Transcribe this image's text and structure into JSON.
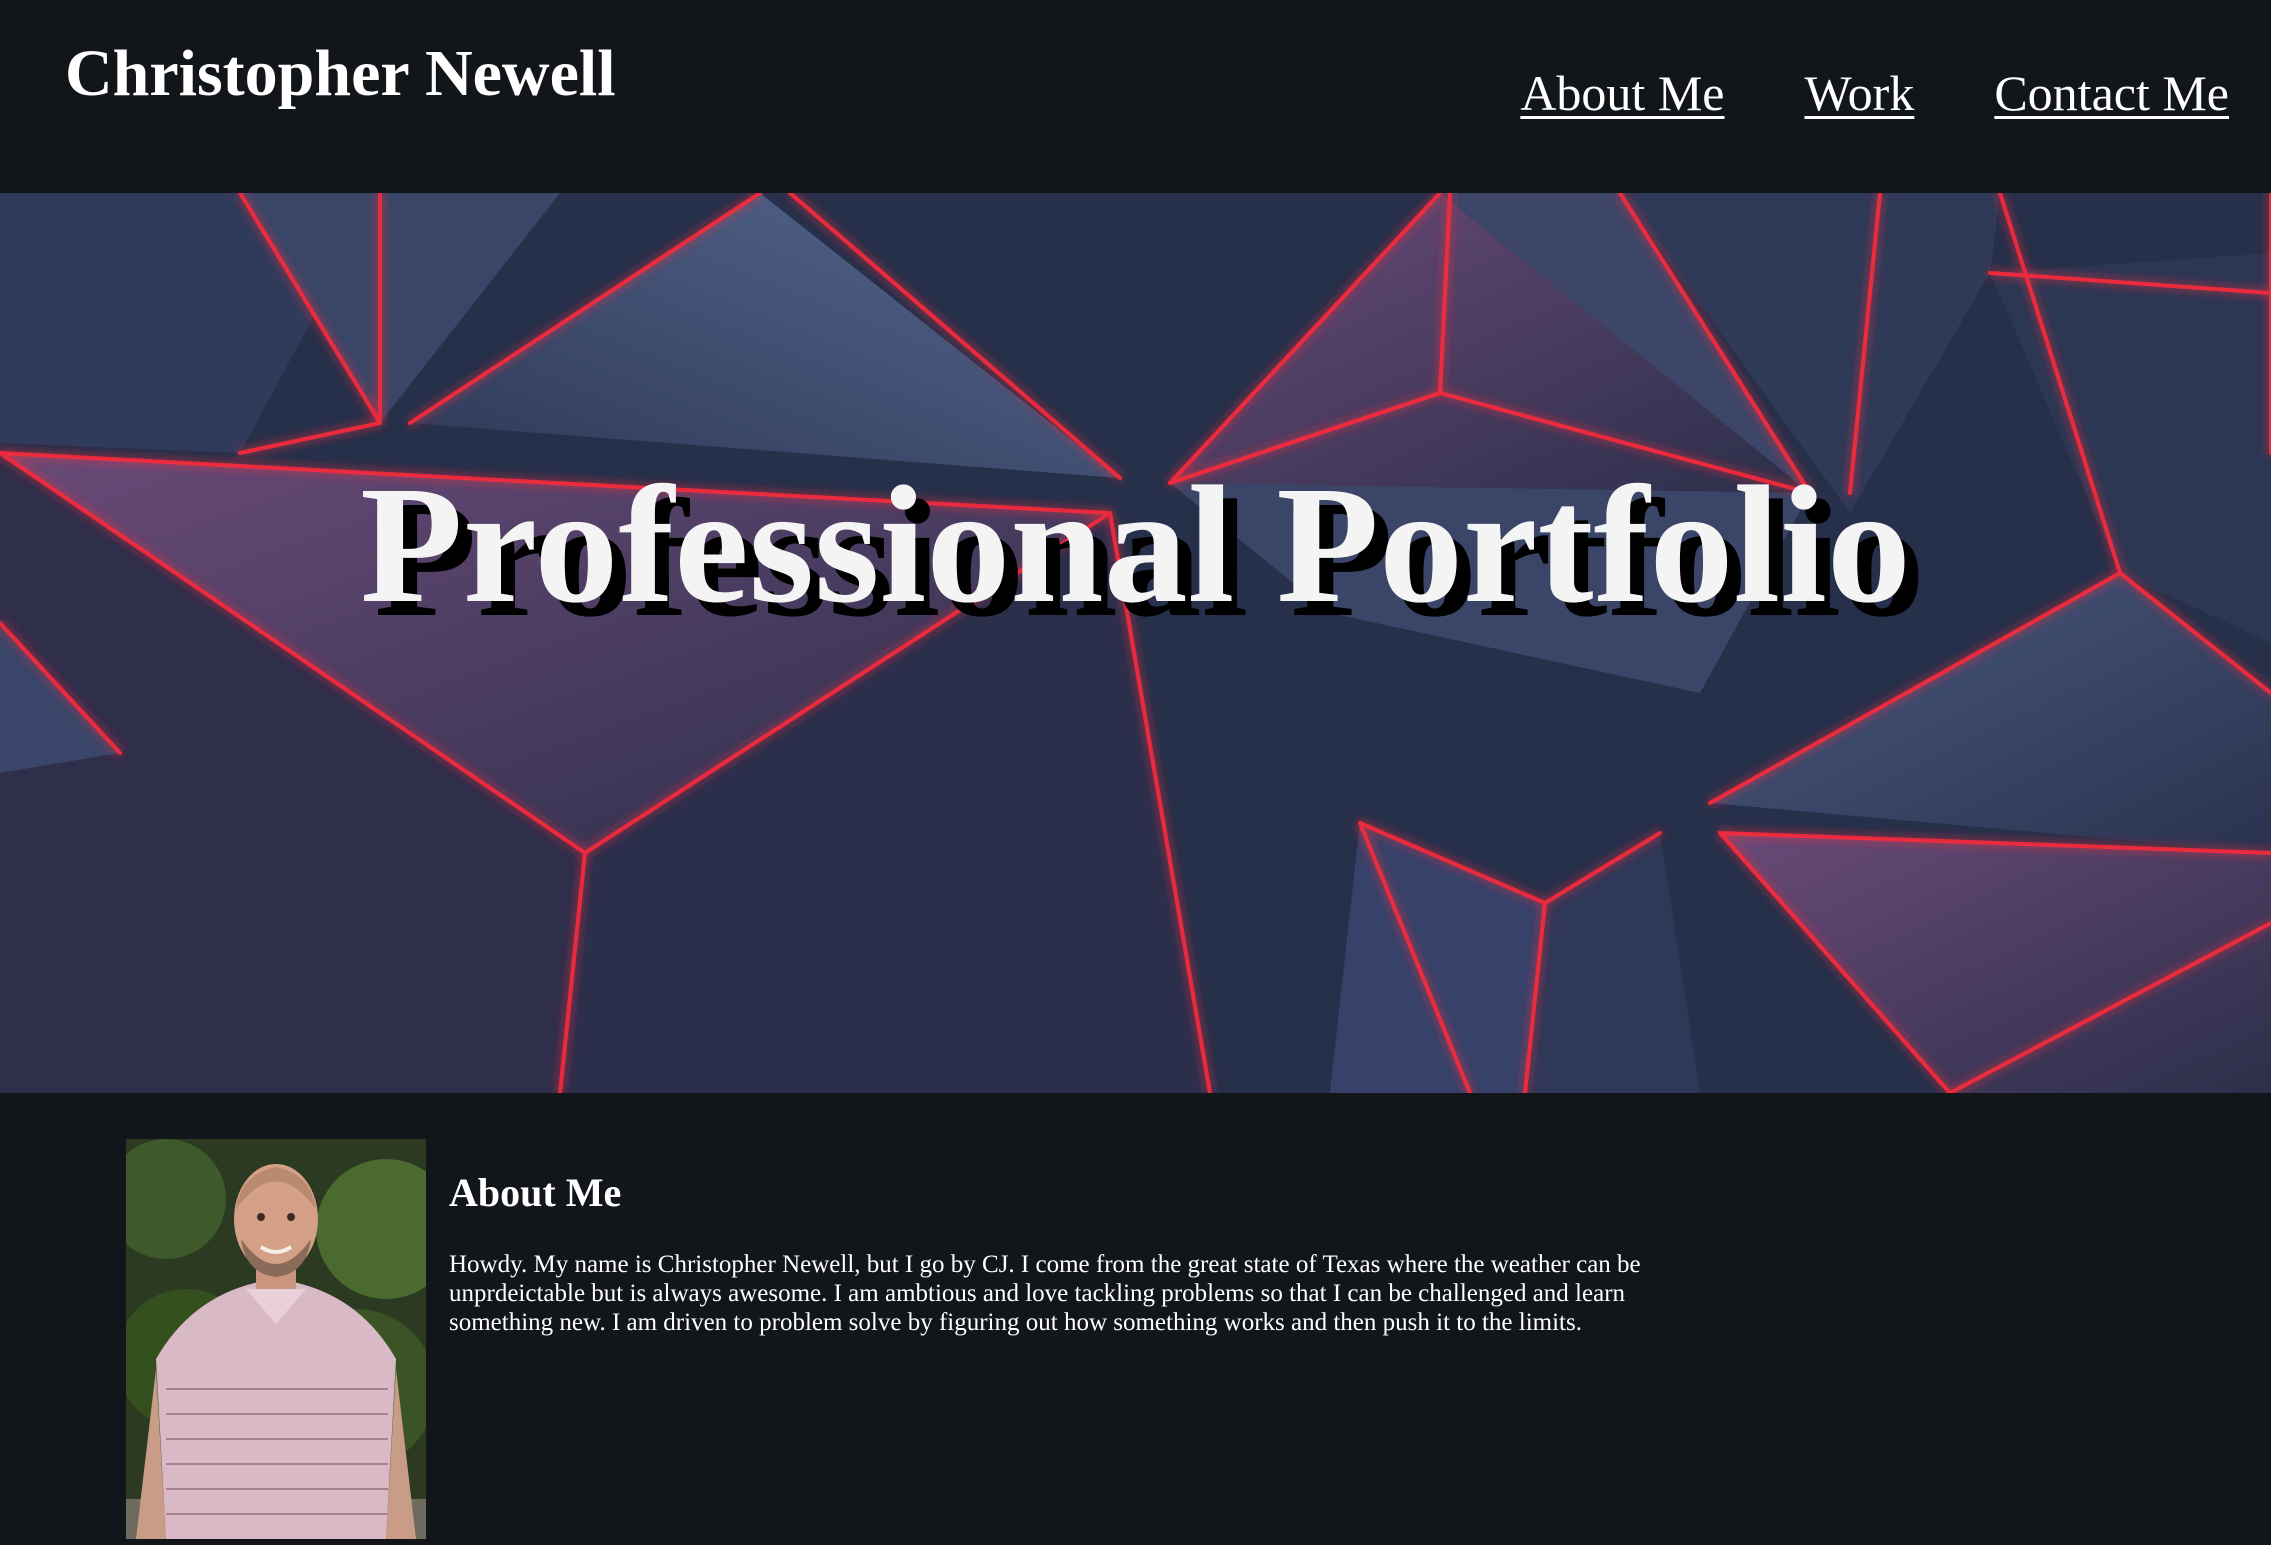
{
  "header": {
    "site_name": "Christopher Newell",
    "nav": [
      {
        "label": "About Me"
      },
      {
        "label": "Work"
      },
      {
        "label": "Contact Me"
      }
    ]
  },
  "hero": {
    "title": "Professional Portfolio",
    "background_image": "dark geometric triangular panels with glowing red edges"
  },
  "about": {
    "heading": "About Me",
    "photo": "portrait photo of a smiling man in a striped pink polo shirt outdoors",
    "body": "Howdy. My name is Christopher Newell, but I go by CJ. I come from the great state of Texas where the weather can be unprdeictable but is always awesome. I am ambtious and love tackling problems so that I can be challenged and learn something new. I am driven to problem solve by figuring out how something works and then push it to the limits."
  },
  "colors": {
    "page_background": "#12161a",
    "hero_base": "#2b3550",
    "neon_red": "#ff2a3a",
    "text": "#ffffff"
  }
}
